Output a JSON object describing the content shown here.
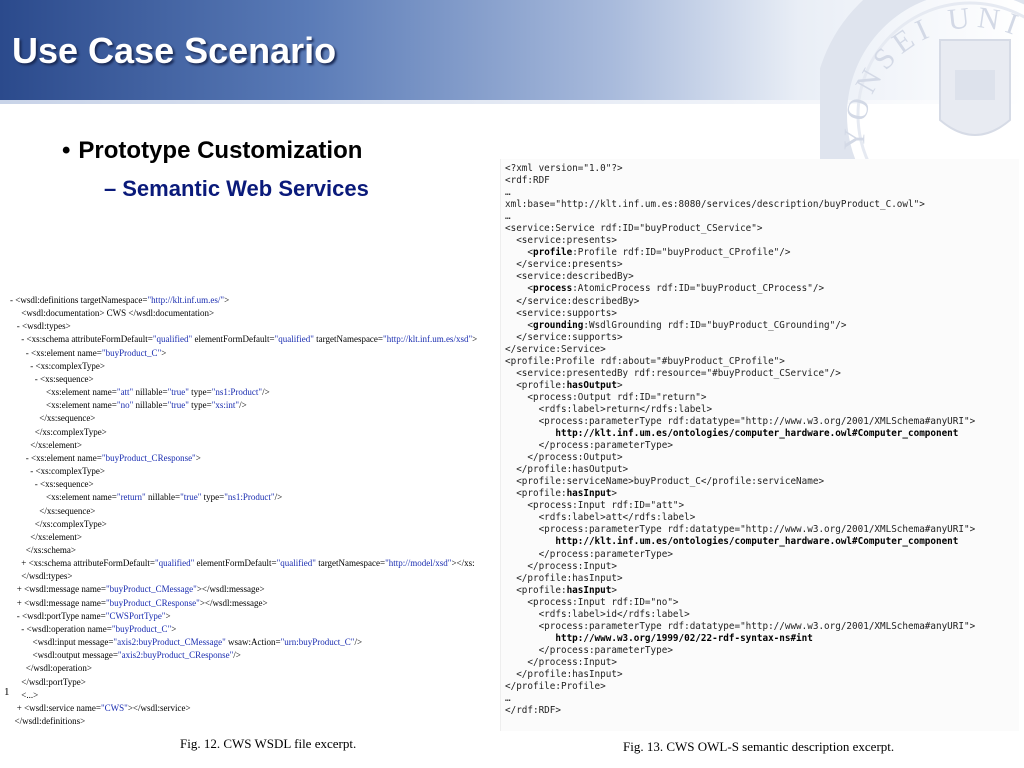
{
  "slide": {
    "title": "Use Case Scenario",
    "bullet_level1": "Prototype Customization",
    "bullet_level2": "Semantic Web Services",
    "bullet_glyph": "•",
    "dash_glyph": "–",
    "seal_text": "YONSEI UNIVERSITY"
  },
  "wsdl": {
    "lines": [
      "- <wsdl:definitions targetNamespace=\"http://klt.inf.um.es/\">",
      "     <wsdl:documentation> CWS </wsdl:documentation>",
      "   - <wsdl:types>",
      "     - <xs:schema attributeFormDefault=\"qualified\" elementFormDefault=\"qualified\" targetNamespace=\"http://klt.inf.um.es/xsd\">",
      "       - <xs:element name=\"buyProduct_C\">",
      "         - <xs:complexType>",
      "           - <xs:sequence>",
      "                <xs:element name=\"att\" nillable=\"true\" type=\"ns1:Product\"/>",
      "                <xs:element name=\"no\" nillable=\"true\" type=\"xs:int\"/>",
      "             </xs:sequence>",
      "           </xs:complexType>",
      "         </xs:element>",
      "       - <xs:element name=\"buyProduct_CResponse\">",
      "         - <xs:complexType>",
      "           - <xs:sequence>",
      "                <xs:element name=\"return\" nillable=\"true\" type=\"ns1:Product\"/>",
      "             </xs:sequence>",
      "           </xs:complexType>",
      "         </xs:element>",
      "       </xs:schema>",
      "     + <xs:schema attributeFormDefault=\"qualified\" elementFormDefault=\"qualified\" targetNamespace=\"http://model/xsd\"></xs:",
      "     </wsdl:types>",
      "   + <wsdl:message name=\"buyProduct_CMessage\"></wsdl:message>",
      "   + <wsdl:message name=\"buyProduct_CResponse\"></wsdl:message>",
      "   - <wsdl:portType name=\"CWSPortType\">",
      "     - <wsdl:operation name=\"buyProduct_C\">",
      "          <wsdl:input message=\"axis2:buyProduct_CMessage\" wsaw:Action=\"urn:buyProduct_C\"/>",
      "          <wsdl:output message=\"axis2:buyProduct_CResponse\"/>",
      "       </wsdl:operation>",
      "     </wsdl:portType>",
      "     <...>",
      "   + <wsdl:service name=\"CWS\"></wsdl:service>",
      "  </wsdl:definitions>"
    ],
    "caption": "Fig. 12.  CWS WSDL file excerpt.",
    "margin_mark": "1"
  },
  "owl": {
    "lines": [
      "<?xml version=\"1.0\"?>",
      "<rdf:RDF",
      "…",
      "xml:base=\"http://klt.inf.um.es:8080/services/description/buyProduct_C.owl\">",
      "…",
      "<service:Service rdf:ID=\"buyProduct_CService\">",
      "  <service:presents>",
      "    <**profile**:Profile rdf:ID=\"buyProduct_CProfile\"/>",
      "  </service:presents>",
      "  <service:describedBy>",
      "    <**process**:AtomicProcess rdf:ID=\"buyProduct_CProcess\"/>",
      "  </service:describedBy>",
      "  <service:supports>",
      "    <**grounding**:WsdlGrounding rdf:ID=\"buyProduct_CGrounding\"/>",
      "  </service:supports>",
      "</service:Service>",
      "<profile:Profile rdf:about=\"#buyProduct_CProfile\">",
      "  <service:presentedBy rdf:resource=\"#buyProduct_CService\"/>",
      "  <profile:**hasOutput**>",
      "    <process:Output rdf:ID=\"return\">",
      "      <rdfs:label>return</rdfs:label>",
      "      <process:parameterType rdf:datatype=\"http://www.w3.org/2001/XMLSchema#anyURI\">",
      "         **http://klt.inf.um.es/ontologies/computer_hardware.owl#Computer_component**",
      "      </process:parameterType>",
      "    </process:Output>",
      "  </profile:hasOutput>",
      "  <profile:serviceName>buyProduct_C</profile:serviceName>",
      "  <profile:**hasInput**>",
      "    <process:Input rdf:ID=\"att\">",
      "      <rdfs:label>att</rdfs:label>",
      "      <process:parameterType rdf:datatype=\"http://www.w3.org/2001/XMLSchema#anyURI\">",
      "         **http://klt.inf.um.es/ontologies/computer_hardware.owl#Computer_component**",
      "      </process:parameterType>",
      "    </process:Input>",
      "  </profile:hasInput>",
      "  <profile:**hasInput**>",
      "    <process:Input rdf:ID=\"no\">",
      "      <rdfs:label>id</rdfs:label>",
      "      <process:parameterType rdf:datatype=\"http://www.w3.org/2001/XMLSchema#anyURI\">",
      "         **http://www.w3.org/1999/02/22-rdf-syntax-ns#int**",
      "      </process:parameterType>",
      "    </process:Input>",
      "  </profile:hasInput>",
      "</profile:Profile>",
      "…",
      "</rdf:RDF>"
    ],
    "caption": "Fig. 13.  CWS OWL-S semantic description excerpt."
  },
  "colors": {
    "title_bar_start": "#2b4a8c",
    "title_text": "#ffffff",
    "subbullet_text": "#0a1a7a",
    "attr_value": "#1a2db0"
  }
}
